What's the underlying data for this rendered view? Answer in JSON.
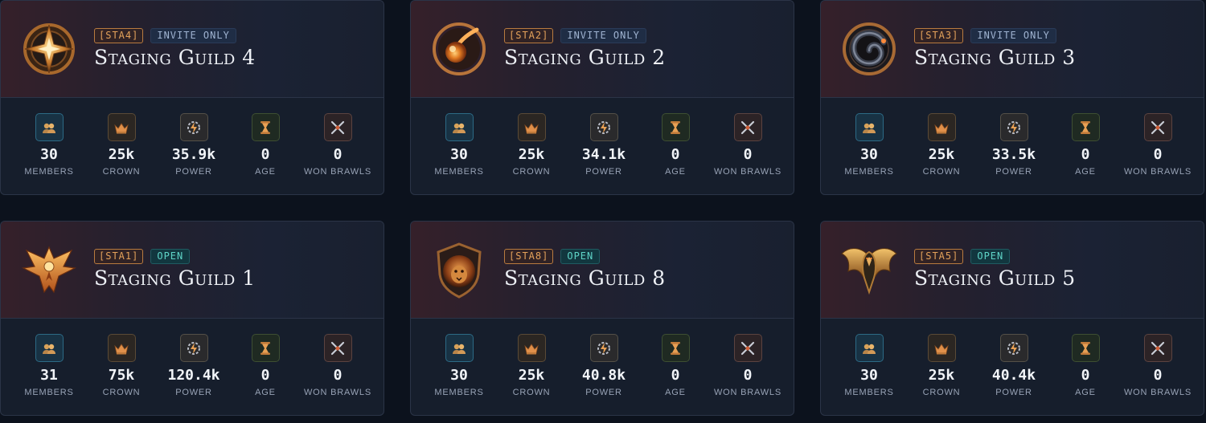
{
  "stat_labels": {
    "members": "MEMBERS",
    "crown": "CROWN",
    "power": "POWER",
    "age": "AGE",
    "won_brawls": "WON BRAWLS"
  },
  "guilds": [
    {
      "tag": "[STA4]",
      "status": "INVITE ONLY",
      "status_type": "invite",
      "name": "Staging Guild 4",
      "emblem": "compass-star-shield-emblem",
      "stats": {
        "members": "30",
        "crown": "25k",
        "power": "35.9k",
        "age": "0",
        "won_brawls": "0"
      }
    },
    {
      "tag": "[STA2]",
      "status": "INVITE ONLY",
      "status_type": "invite",
      "name": "Staging Guild 2",
      "emblem": "comet-orb-emblem",
      "stats": {
        "members": "30",
        "crown": "25k",
        "power": "34.1k",
        "age": "0",
        "won_brawls": "0"
      }
    },
    {
      "tag": "[STA3]",
      "status": "INVITE ONLY",
      "status_type": "invite",
      "name": "Staging Guild 3",
      "emblem": "dragon-ring-emblem",
      "stats": {
        "members": "30",
        "crown": "25k",
        "power": "33.5k",
        "age": "0",
        "won_brawls": "0"
      }
    },
    {
      "tag": "[STA1]",
      "status": "OPEN",
      "status_type": "open",
      "name": "Staging Guild 1",
      "emblem": "phoenix-emblem",
      "stats": {
        "members": "31",
        "crown": "75k",
        "power": "120.4k",
        "age": "0",
        "won_brawls": "0"
      }
    },
    {
      "tag": "[STA8]",
      "status": "OPEN",
      "status_type": "open",
      "name": "Staging Guild 8",
      "emblem": "lion-shield-emblem",
      "stats": {
        "members": "30",
        "crown": "25k",
        "power": "40.8k",
        "age": "0",
        "won_brawls": "0"
      }
    },
    {
      "tag": "[STA5]",
      "status": "OPEN",
      "status_type": "open",
      "name": "Staging Guild 5",
      "emblem": "eagle-wings-emblem",
      "stats": {
        "members": "30",
        "crown": "25k",
        "power": "40.4k",
        "age": "0",
        "won_brawls": "0"
      }
    }
  ],
  "colors": {
    "background": "#0c121d",
    "card": "#161e2c",
    "tag_accent": "#e3a15a",
    "open_status": "#5fd4c7",
    "invite_status": "#9fb3d1"
  }
}
